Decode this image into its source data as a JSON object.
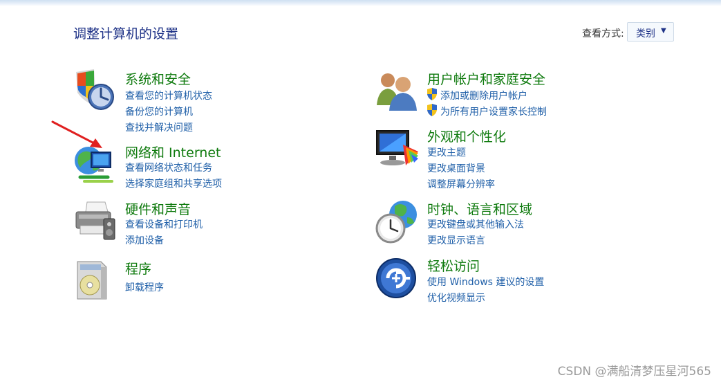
{
  "header": {
    "title": "调整计算机的设置",
    "view_by_label": "查看方式:",
    "view_by_value": "类别"
  },
  "categories": [
    {
      "title": "系统和安全",
      "links": [
        "查看您的计算机状态",
        "备份您的计算机",
        "查找并解决问题"
      ],
      "icon": "shield-clock-icon"
    },
    {
      "title": "网络和 Internet",
      "links": [
        "查看网络状态和任务",
        "选择家庭组和共享选项"
      ],
      "icon": "globe-network-icon"
    },
    {
      "title": "硬件和声音",
      "links": [
        "查看设备和打印机",
        "添加设备"
      ],
      "icon": "printer-icon"
    },
    {
      "title": "程序",
      "links": [
        "卸载程序"
      ],
      "icon": "programs-box-icon"
    },
    {
      "title": "用户帐户和家庭安全",
      "links": [
        "添加或删除用户帐户",
        "为所有用户设置家长控制"
      ],
      "icon": "users-icon",
      "link_shields": true
    },
    {
      "title": "外观和个性化",
      "links": [
        "更改主题",
        "更改桌面背景",
        "调整屏幕分辨率"
      ],
      "icon": "monitor-palette-icon"
    },
    {
      "title": "时钟、语言和区域",
      "links": [
        "更改键盘或其他输入法",
        "更改显示语言"
      ],
      "icon": "globe-clock-icon"
    },
    {
      "title": "轻松访问",
      "links": [
        "使用 Windows 建议的设置",
        "优化视频显示"
      ],
      "icon": "ease-of-access-icon"
    }
  ],
  "watermark": "CSDN @满船清梦压星河565",
  "colors": {
    "title_green": "#0e7a0d",
    "link_blue": "#1f5fa8",
    "header_blue": "#1e3287",
    "arrow_red": "#e02020"
  }
}
